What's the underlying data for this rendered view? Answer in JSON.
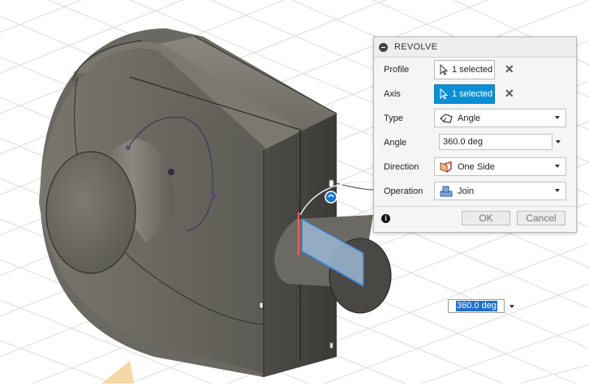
{
  "dialog": {
    "title": "REVOLVE",
    "profile": {
      "label": "Profile",
      "value": "1 selected"
    },
    "axis": {
      "label": "Axis",
      "value": "1 selected"
    },
    "type": {
      "label": "Type",
      "value": "Angle",
      "icon": "angle-icon"
    },
    "angle": {
      "label": "Angle",
      "value": "360.0 deg"
    },
    "direction": {
      "label": "Direction",
      "value": "One Side",
      "icon": "one-side-icon"
    },
    "operation": {
      "label": "Operation",
      "value": "Join",
      "icon": "join-icon"
    },
    "ok_label": "OK",
    "cancel_label": "Cancel"
  },
  "viewport": {
    "angle_input_value": "360.0 deg"
  },
  "colors": {
    "accent": "#0d8fd6",
    "body": "#5a5852",
    "grid": "#d9d9d9",
    "highlight": "#ff8080",
    "preview": "#8fb4d6"
  }
}
